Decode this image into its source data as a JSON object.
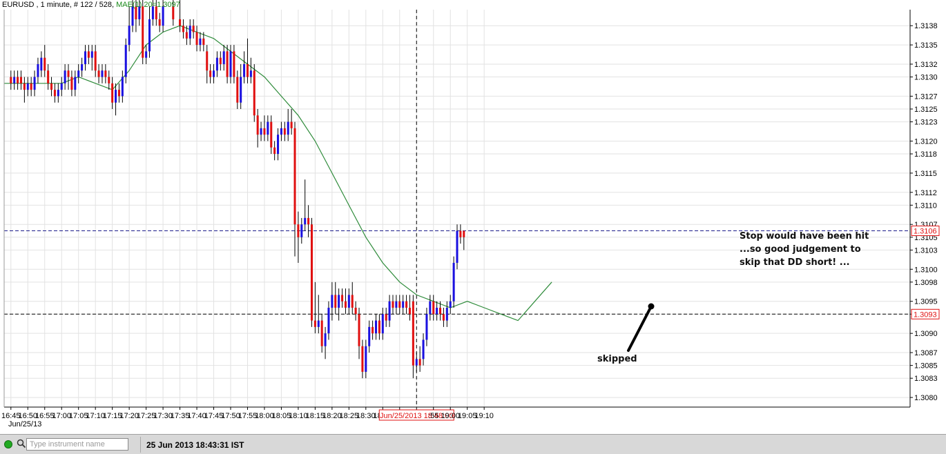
{
  "header": {
    "symbol_text": "EURUSD , 1 minute, # 122 / 528,",
    "ma_text": "MAE(1) 20=1.3097"
  },
  "date_label": "Jun/25/13",
  "annotations": {
    "stop_line1": "Stop would have been hit",
    "stop_line2": "...so good judgement to",
    "stop_line3": "skip that DD short! ...",
    "skipped": "skipped"
  },
  "status_bar": {
    "search_placeholder": "Type instrument name",
    "datetime": "25 Jun 2013 18:43:31 IST"
  },
  "colors": {
    "bull": "#1a10e0",
    "bear": "#e01010",
    "ma": "#2e8b3a",
    "grid": "#e2e2e2",
    "hline": "#1a1a8a"
  },
  "chart_data": {
    "type": "candlestick",
    "instrument": "EURUSD",
    "timeframe": "1 minute",
    "x_tick_labels": [
      "16:45",
      "16:50",
      "16:55",
      "17:00",
      "17:05",
      "17:10",
      "17:15",
      "17:20",
      "17:25",
      "17:30",
      "17:35",
      "17:40",
      "17:45",
      "17:50",
      "17:55",
      "18:00",
      "18:05",
      "18:10",
      "18:15",
      "18:20",
      "18:25",
      "18:30",
      "18:35",
      "18:40",
      "Jun/25/2013 18:48:00",
      ":55",
      "19:00",
      "19:05",
      "19:10"
    ],
    "y_tick_labels": [
      "1.3080",
      "1.3083",
      "1.3085",
      "1.3087",
      "1.3090",
      "1.3093",
      "1.3095",
      "1.3098",
      "1.3100",
      "1.3103",
      "1.3105",
      "1.3107",
      "1.3110",
      "1.3112",
      "1.3115",
      "1.3118",
      "1.3120",
      "1.3123",
      "1.3125",
      "1.3127",
      "1.3130",
      "1.3132",
      "1.3135",
      "1.3138"
    ],
    "ylim": [
      1.30785,
      1.31405
    ],
    "x_range_minutes": [
      -2,
      266
    ],
    "x_origin_time": "16:45",
    "grid": true,
    "cursor_time_label": "Jun/25/2013 18:48:00",
    "price_lines": [
      {
        "value": 1.3106,
        "label": "1.3106",
        "label_color": "#e01010",
        "style": "dashed",
        "color": "#1a1a8a"
      },
      {
        "value": 1.3093,
        "label": "1.3093",
        "label_color": "#e01010",
        "style": "dashed",
        "color": "#000000"
      }
    ],
    "ma": {
      "name": "MAE(1) 20",
      "last_value": 1.3097,
      "points": [
        [
          -2,
          1.3129
        ],
        [
          5,
          1.3129
        ],
        [
          10,
          1.3129
        ],
        [
          15,
          1.3129
        ],
        [
          20,
          1.313
        ],
        [
          25,
          1.3129
        ],
        [
          30,
          1.3128
        ],
        [
          35,
          1.3131
        ],
        [
          40,
          1.3135
        ],
        [
          45,
          1.3137
        ],
        [
          50,
          1.3138
        ],
        [
          55,
          1.3137
        ],
        [
          60,
          1.3136
        ],
        [
          65,
          1.3134
        ],
        [
          70,
          1.3132
        ],
        [
          75,
          1.313
        ],
        [
          80,
          1.3127
        ],
        [
          85,
          1.3124
        ],
        [
          90,
          1.312
        ],
        [
          95,
          1.3115
        ],
        [
          100,
          1.311
        ],
        [
          105,
          1.3105
        ],
        [
          110,
          1.3101
        ],
        [
          115,
          1.3098
        ],
        [
          120,
          1.3096
        ],
        [
          125,
          1.3095
        ],
        [
          130,
          1.3094
        ],
        [
          135,
          1.3095
        ],
        [
          140,
          1.3094
        ],
        [
          145,
          1.3093
        ],
        [
          150,
          1.3092
        ],
        [
          155,
          1.3095
        ],
        [
          160,
          1.3098
        ]
      ]
    },
    "candles": [
      [
        0,
        1.313,
        1.3129,
        1.3131,
        1.3128
      ],
      [
        1,
        1.3129,
        1.313,
        1.3131,
        1.3128
      ],
      [
        2,
        1.313,
        1.3129,
        1.3131,
        1.3128
      ],
      [
        3,
        1.313,
        1.3129,
        1.3131,
        1.3128
      ],
      [
        4,
        1.3129,
        1.3128,
        1.313,
        1.3126
      ],
      [
        5,
        1.3128,
        1.3129,
        1.313,
        1.3127
      ],
      [
        6,
        1.3129,
        1.3128,
        1.313,
        1.3127
      ],
      [
        7,
        1.3128,
        1.313,
        1.3131,
        1.3127
      ],
      [
        8,
        1.313,
        1.3132,
        1.3133,
        1.3129
      ],
      [
        9,
        1.3131,
        1.3133,
        1.3134,
        1.313
      ],
      [
        10,
        1.3133,
        1.3131,
        1.3135,
        1.313
      ],
      [
        11,
        1.3131,
        1.3129,
        1.3132,
        1.3128
      ],
      [
        12,
        1.3129,
        1.3128,
        1.313,
        1.3127
      ],
      [
        13,
        1.3128,
        1.3127,
        1.3129,
        1.3126
      ],
      [
        14,
        1.3127,
        1.3128,
        1.3129,
        1.3126
      ],
      [
        15,
        1.3128,
        1.3129,
        1.313,
        1.3127
      ],
      [
        16,
        1.3129,
        1.3131,
        1.3132,
        1.3128
      ],
      [
        17,
        1.3131,
        1.313,
        1.3132,
        1.3128
      ],
      [
        18,
        1.313,
        1.3128,
        1.3131,
        1.3127
      ],
      [
        19,
        1.3128,
        1.313,
        1.3131,
        1.3127
      ],
      [
        20,
        1.313,
        1.3131,
        1.3132,
        1.3129
      ],
      [
        21,
        1.3131,
        1.3132,
        1.3133,
        1.313
      ],
      [
        22,
        1.3132,
        1.3134,
        1.3135,
        1.3131
      ],
      [
        23,
        1.3134,
        1.3133,
        1.3135,
        1.3132
      ],
      [
        24,
        1.3133,
        1.3134,
        1.3135,
        1.3131
      ],
      [
        25,
        1.3134,
        1.3131,
        1.3135,
        1.313
      ],
      [
        26,
        1.3131,
        1.313,
        1.3132,
        1.3129
      ],
      [
        27,
        1.313,
        1.3131,
        1.3132,
        1.3129
      ],
      [
        28,
        1.3131,
        1.313,
        1.3132,
        1.3129
      ],
      [
        29,
        1.313,
        1.3129,
        1.3131,
        1.3128
      ],
      [
        30,
        1.3129,
        1.3126,
        1.313,
        1.3125
      ],
      [
        31,
        1.3126,
        1.3128,
        1.3129,
        1.3124
      ],
      [
        32,
        1.3128,
        1.3127,
        1.3129,
        1.3126
      ],
      [
        33,
        1.3127,
        1.313,
        1.3131,
        1.3126
      ],
      [
        34,
        1.313,
        1.3135,
        1.3136,
        1.3129
      ],
      [
        35,
        1.3135,
        1.3138,
        1.3141,
        1.3134
      ],
      [
        36,
        1.3138,
        1.3141,
        1.3142,
        1.3137
      ],
      [
        37,
        1.3141,
        1.3139,
        1.3142,
        1.3137
      ],
      [
        38,
        1.3139,
        1.3141,
        1.3142,
        1.3138
      ],
      [
        39,
        1.3141,
        1.3133,
        1.3142,
        1.3132
      ],
      [
        40,
        1.3133,
        1.3134,
        1.3135,
        1.3132
      ],
      [
        41,
        1.3134,
        1.3139,
        1.3141,
        1.3133
      ],
      [
        42,
        1.3139,
        1.3141,
        1.3142,
        1.3138
      ],
      [
        43,
        1.3141,
        1.3139,
        1.3142,
        1.3138
      ],
      [
        44,
        1.3139,
        1.3138,
        1.314,
        1.3137
      ],
      [
        45,
        1.3138,
        1.3141,
        1.3142,
        1.3137
      ],
      [
        48,
        1.3141,
        1.3139,
        1.3142,
        1.3138
      ],
      [
        50,
        1.3139,
        1.3138,
        1.3142,
        1.3137
      ],
      [
        51,
        1.3138,
        1.3137,
        1.3139,
        1.3136
      ],
      [
        52,
        1.3137,
        1.3136,
        1.3138,
        1.3135
      ],
      [
        53,
        1.3136,
        1.3138,
        1.3139,
        1.3135
      ],
      [
        54,
        1.3138,
        1.3137,
        1.3139,
        1.3136
      ],
      [
        55,
        1.3137,
        1.3135,
        1.3138,
        1.3134
      ],
      [
        56,
        1.3135,
        1.3136,
        1.3137,
        1.3134
      ],
      [
        57,
        1.3136,
        1.3135,
        1.3137,
        1.3134
      ],
      [
        58,
        1.3134,
        1.3131,
        1.3135,
        1.3129
      ],
      [
        59,
        1.3131,
        1.313,
        1.3132,
        1.3129
      ],
      [
        60,
        1.313,
        1.3131,
        1.3132,
        1.3129
      ],
      [
        61,
        1.3131,
        1.3133,
        1.3134,
        1.313
      ],
      [
        62,
        1.3133,
        1.3132,
        1.3134,
        1.3131
      ],
      [
        63,
        1.3132,
        1.3134,
        1.3135,
        1.3131
      ],
      [
        64,
        1.3134,
        1.313,
        1.3135,
        1.3129
      ],
      [
        65,
        1.313,
        1.3134,
        1.3135,
        1.3129
      ],
      [
        66,
        1.3134,
        1.313,
        1.3135,
        1.3129
      ],
      [
        67,
        1.313,
        1.3126,
        1.3131,
        1.3125
      ],
      [
        68,
        1.3126,
        1.313,
        1.3132,
        1.3125
      ],
      [
        69,
        1.313,
        1.3132,
        1.3134,
        1.3129
      ],
      [
        70,
        1.3132,
        1.313,
        1.3136,
        1.3129
      ],
      [
        71,
        1.313,
        1.3131,
        1.3133,
        1.3129
      ],
      [
        72,
        1.3131,
        1.3124,
        1.3132,
        1.3123
      ],
      [
        73,
        1.3124,
        1.3121,
        1.3125,
        1.3119
      ],
      [
        74,
        1.3121,
        1.3122,
        1.3123,
        1.312
      ],
      [
        75,
        1.3122,
        1.3121,
        1.3124,
        1.312
      ],
      [
        76,
        1.3121,
        1.3123,
        1.3124,
        1.312
      ],
      [
        77,
        1.3123,
        1.3119,
        1.3124,
        1.3118
      ],
      [
        78,
        1.3119,
        1.3118,
        1.312,
        1.3117
      ],
      [
        79,
        1.3118,
        1.3121,
        1.3122,
        1.3117
      ],
      [
        80,
        1.3121,
        1.3122,
        1.3123,
        1.312
      ],
      [
        81,
        1.3122,
        1.3121,
        1.3123,
        1.312
      ],
      [
        82,
        1.3121,
        1.3123,
        1.3125,
        1.312
      ],
      [
        83,
        1.3123,
        1.3122,
        1.3125,
        1.3121
      ],
      [
        84,
        1.3122,
        1.3107,
        1.3123,
        1.3102
      ],
      [
        85,
        1.3107,
        1.3105,
        1.3109,
        1.3101
      ],
      [
        86,
        1.3105,
        1.3107,
        1.3108,
        1.3104
      ],
      [
        87,
        1.3107,
        1.3108,
        1.3114,
        1.3106
      ],
      [
        88,
        1.3108,
        1.3107,
        1.311,
        1.3105
      ],
      [
        89,
        1.3107,
        1.3092,
        1.3108,
        1.3091
      ],
      [
        90,
        1.3092,
        1.3091,
        1.3098,
        1.309
      ],
      [
        91,
        1.3091,
        1.3092,
        1.3096,
        1.309
      ],
      [
        92,
        1.3092,
        1.3088,
        1.3093,
        1.3087
      ],
      [
        93,
        1.3088,
        1.309,
        1.3091,
        1.3086
      ],
      [
        94,
        1.309,
        1.3094,
        1.3095,
        1.3089
      ],
      [
        95,
        1.3094,
        1.3096,
        1.3098,
        1.3092
      ],
      [
        96,
        1.3096,
        1.3094,
        1.3098,
        1.3093
      ],
      [
        97,
        1.3094,
        1.3096,
        1.3097,
        1.3092
      ],
      [
        98,
        1.3096,
        1.3095,
        1.3097,
        1.3094
      ],
      [
        99,
        1.3095,
        1.3094,
        1.3097,
        1.3093
      ],
      [
        100,
        1.3094,
        1.3096,
        1.3097,
        1.3093
      ],
      [
        101,
        1.3096,
        1.3094,
        1.3098,
        1.3093
      ],
      [
        102,
        1.3094,
        1.3093,
        1.3095,
        1.3092
      ],
      [
        103,
        1.3093,
        1.3088,
        1.3094,
        1.3086
      ],
      [
        104,
        1.3088,
        1.3084,
        1.3089,
        1.3083
      ],
      [
        105,
        1.3084,
        1.3088,
        1.3089,
        1.3083
      ],
      [
        106,
        1.3088,
        1.3091,
        1.3092,
        1.3087
      ],
      [
        107,
        1.3091,
        1.309,
        1.3092,
        1.3089
      ],
      [
        108,
        1.309,
        1.3092,
        1.3093,
        1.3089
      ],
      [
        109,
        1.3092,
        1.309,
        1.3093,
        1.3089
      ],
      [
        110,
        1.309,
        1.3093,
        1.3094,
        1.3089
      ],
      [
        111,
        1.3093,
        1.3092,
        1.3094,
        1.3091
      ],
      [
        112,
        1.3092,
        1.3095,
        1.3096,
        1.3091
      ],
      [
        113,
        1.3095,
        1.3094,
        1.3096,
        1.3093
      ],
      [
        114,
        1.3094,
        1.3095,
        1.3096,
        1.3093
      ],
      [
        115,
        1.3095,
        1.3094,
        1.3096,
        1.3093
      ],
      [
        116,
        1.3094,
        1.3095,
        1.3096,
        1.3093
      ],
      [
        117,
        1.3095,
        1.3094,
        1.3096,
        1.3093
      ],
      [
        118,
        1.3094,
        1.3093,
        1.3096,
        1.3092
      ],
      [
        119,
        1.3095,
        1.3085,
        1.3096,
        1.3083
      ],
      [
        120,
        1.3085,
        1.3086,
        1.3087,
        1.3084
      ],
      [
        121,
        1.3086,
        1.3085,
        1.3088,
        1.3084
      ],
      [
        122,
        1.3086,
        1.3089,
        1.309,
        1.3085
      ],
      [
        123,
        1.3089,
        1.3093,
        1.3094,
        1.3088
      ],
      [
        124,
        1.3093,
        1.3095,
        1.3096,
        1.3092
      ],
      [
        125,
        1.3095,
        1.3093,
        1.3096,
        1.3092
      ],
      [
        126,
        1.3093,
        1.3094,
        1.3095,
        1.3092
      ],
      [
        127,
        1.3094,
        1.3093,
        1.3095,
        1.3092
      ],
      [
        128,
        1.3093,
        1.3092,
        1.3094,
        1.3091
      ],
      [
        129,
        1.3092,
        1.3094,
        1.3095,
        1.3091
      ],
      [
        130,
        1.3094,
        1.3095,
        1.3096,
        1.3093
      ],
      [
        131,
        1.3095,
        1.3101,
        1.3102,
        1.3094
      ],
      [
        132,
        1.3101,
        1.3106,
        1.3107,
        1.31
      ],
      [
        133,
        1.3106,
        1.3105,
        1.3107,
        1.3104
      ],
      [
        134,
        1.3106,
        1.3105,
        1.3106,
        1.3103
      ]
    ]
  }
}
